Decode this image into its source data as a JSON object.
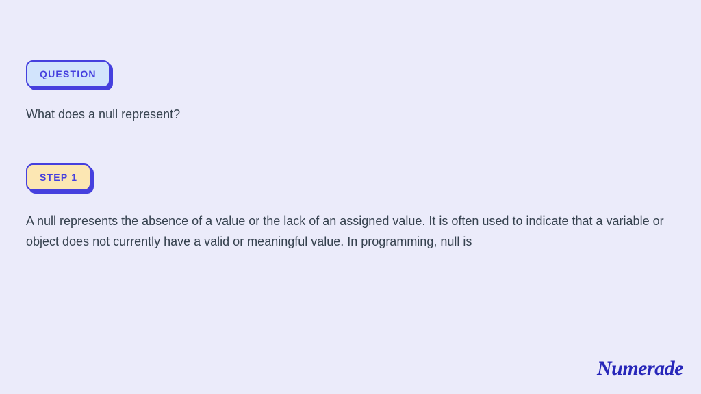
{
  "question": {
    "badge_label": "QUESTION",
    "text": "What does a null represent?"
  },
  "step": {
    "badge_label": "STEP 1",
    "text": "A null represents the absence of a value or the lack of an assigned value. It is often used to indicate that a variable or object does not currently have a valid or meaningful value. In programming, null is"
  },
  "brand": {
    "name": "Numerade"
  }
}
